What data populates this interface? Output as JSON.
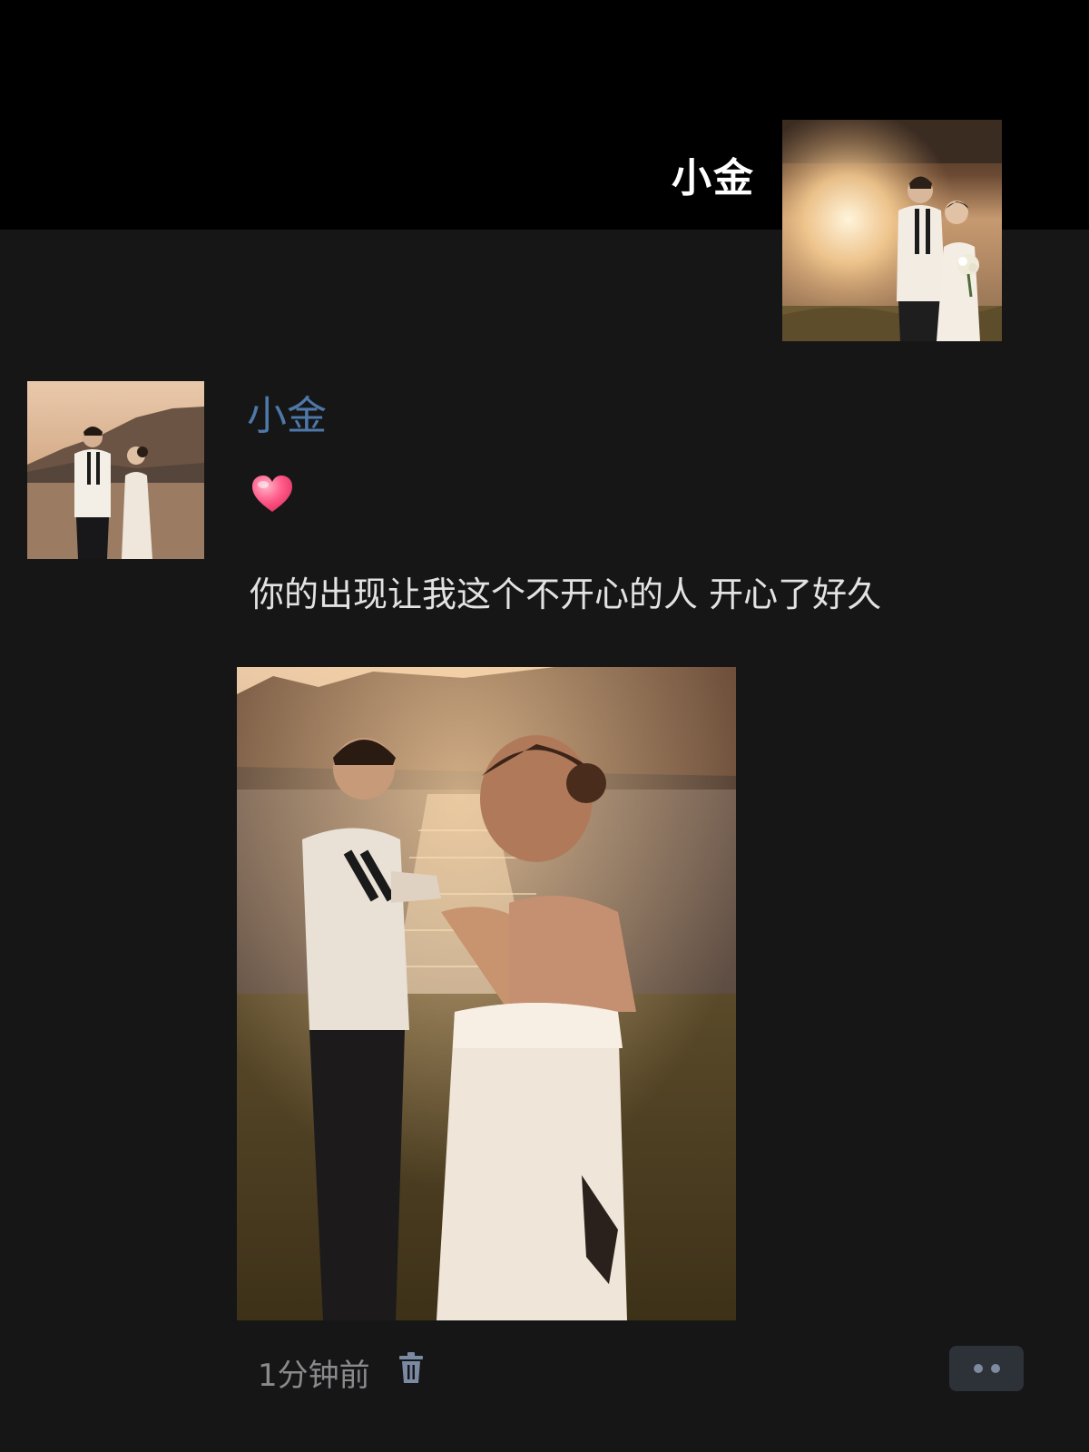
{
  "cover": {
    "name": "小金"
  },
  "post": {
    "author": "小金",
    "emoji_icon": "red-heart-icon",
    "text": "你的出现让我这个不开心的人 开心了好久",
    "time": "1分钟前",
    "delete_icon": "trash-icon",
    "more_icon": "ellipsis-icon"
  },
  "colors": {
    "cover_background": "#000000",
    "page_background": "#161617",
    "author_name": "#4d78a8",
    "post_text": "#e2e2e2",
    "time_text": "#8a8a8c",
    "action_button_background": "#2d3138"
  }
}
